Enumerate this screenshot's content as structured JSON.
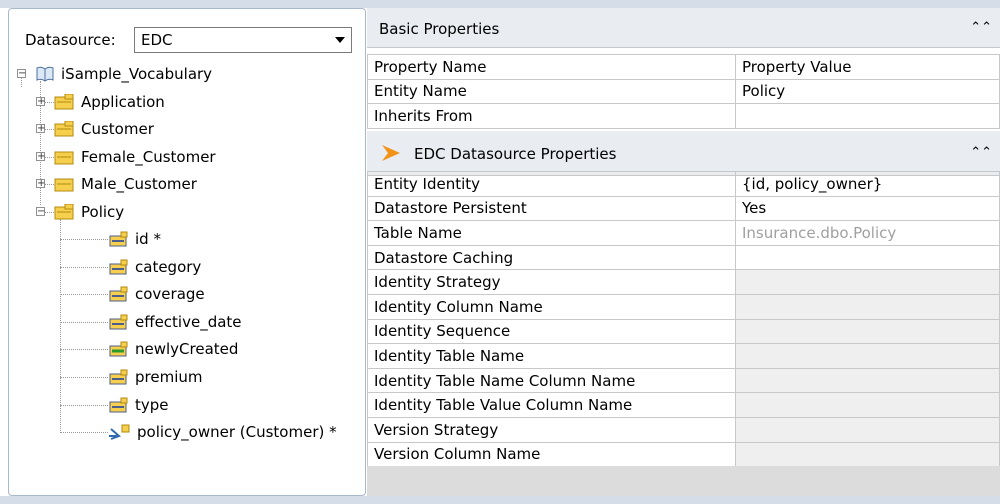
{
  "datasource": {
    "label": "Datasource:",
    "selected": "EDC"
  },
  "tree": {
    "root": "iSample_Vocabulary",
    "entities": [
      {
        "label": "Application",
        "icon": "folder-yellow-icon"
      },
      {
        "label": "Customer",
        "icon": "folder-yellow-icon"
      },
      {
        "label": "Female_Customer",
        "icon": "folder-yellow-icon"
      },
      {
        "label": "Male_Customer",
        "icon": "folder-yellow-icon"
      },
      {
        "label": "Policy",
        "icon": "folder-yellow-icon"
      }
    ],
    "policy_children": [
      {
        "label": "id *",
        "icon": "attribute-icon"
      },
      {
        "label": "category",
        "icon": "attribute-icon"
      },
      {
        "label": "coverage",
        "icon": "attribute-icon"
      },
      {
        "label": "effective_date",
        "icon": "attribute-icon"
      },
      {
        "label": "newlyCreated",
        "icon": "attribute-green-icon"
      },
      {
        "label": "premium",
        "icon": "attribute-icon"
      },
      {
        "label": "type",
        "icon": "attribute-icon"
      },
      {
        "label": "policy_owner (Customer) *",
        "icon": "association-icon"
      }
    ]
  },
  "basic": {
    "title": "Basic Properties",
    "col_name": "Property Name",
    "col_value": "Property Value",
    "rows": [
      {
        "name": "Entity Name",
        "value": "Policy"
      },
      {
        "name": "Inherits From",
        "value": ""
      }
    ]
  },
  "edc": {
    "title": "EDC Datasource Properties",
    "rows": [
      {
        "name": "Entity Identity",
        "value": "{id, policy_owner}"
      },
      {
        "name": "Datastore Persistent",
        "value": "Yes"
      },
      {
        "name": "Table Name",
        "value": "Insurance.dbo.Policy"
      },
      {
        "name": "Datastore Caching",
        "value": ""
      },
      {
        "name": "Identity Strategy",
        "value": ""
      },
      {
        "name": "Identity Column Name",
        "value": ""
      },
      {
        "name": "Identity Sequence",
        "value": ""
      },
      {
        "name": "Identity Table Name",
        "value": ""
      },
      {
        "name": "Identity Table Name Column Name",
        "value": ""
      },
      {
        "name": "Identity Table Value Column Name",
        "value": ""
      },
      {
        "name": "Version Strategy",
        "value": ""
      },
      {
        "name": "Version Column Name",
        "value": ""
      }
    ]
  }
}
